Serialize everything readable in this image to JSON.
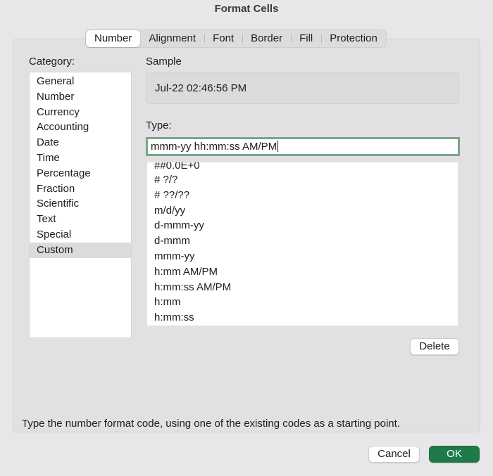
{
  "window": {
    "title": "Format Cells"
  },
  "tabs": [
    {
      "label": "Number",
      "active": true
    },
    {
      "label": "Alignment",
      "active": false
    },
    {
      "label": "Font",
      "active": false
    },
    {
      "label": "Border",
      "active": false
    },
    {
      "label": "Fill",
      "active": false
    },
    {
      "label": "Protection",
      "active": false
    }
  ],
  "category": {
    "label": "Category:",
    "items": [
      "General",
      "Number",
      "Currency",
      "Accounting",
      "Date",
      "Time",
      "Percentage",
      "Fraction",
      "Scientific",
      "Text",
      "Special",
      "Custom"
    ],
    "selected": "Custom"
  },
  "sample": {
    "label": "Sample",
    "value": "Jul-22 02:46:56 PM"
  },
  "type": {
    "label": "Type:",
    "value": "mmm-yy hh:mm:ss AM/PM",
    "formats": [
      "##0.0E+0",
      "# ?/?",
      "# ??/??",
      "m/d/yy",
      "d-mmm-yy",
      "d-mmm",
      "mmm-yy",
      "h:mm AM/PM",
      "h:mm:ss AM/PM",
      "h:mm",
      "h:mm:ss"
    ]
  },
  "buttons": {
    "delete": "Delete",
    "cancel": "Cancel",
    "ok": "OK"
  },
  "hint": "Type the number format code, using one of the existing codes as a starting point.",
  "colors": {
    "accent": "#1e7a48",
    "focus_ring": "#7aa687",
    "dialog_bg": "#e8e6e9"
  }
}
